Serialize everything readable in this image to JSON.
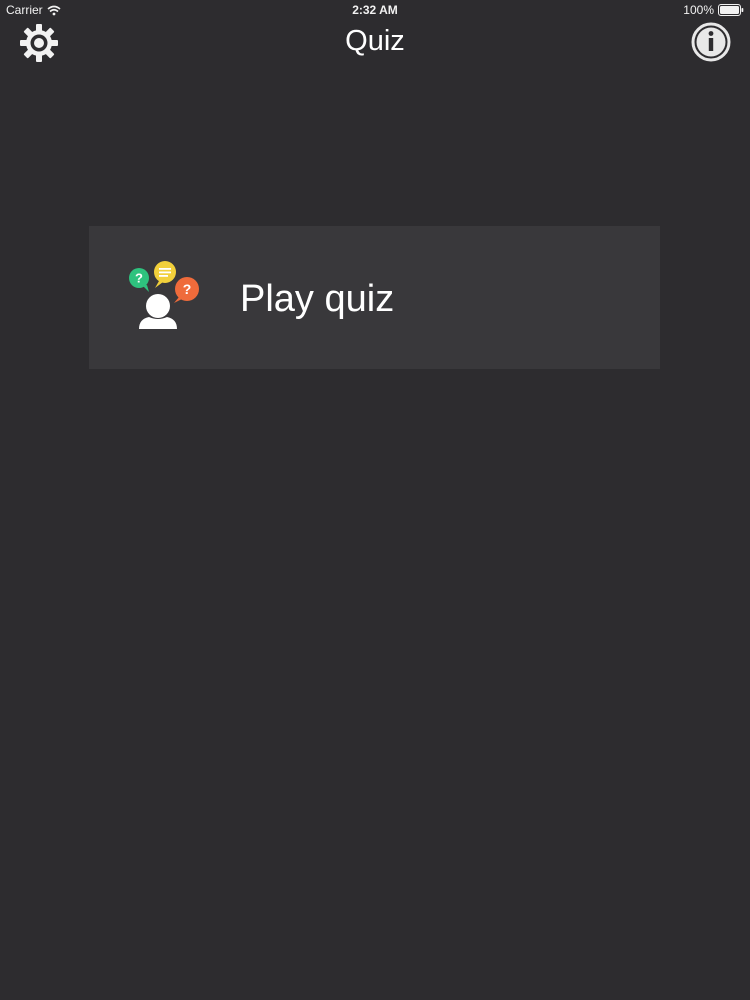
{
  "status_bar": {
    "carrier": "Carrier",
    "time": "2:32 AM",
    "battery": "100%"
  },
  "nav": {
    "title": "Quiz",
    "left_icon": "gear-icon",
    "right_icon": "info-icon"
  },
  "menu": {
    "items": [
      {
        "label": "Play quiz",
        "icon": "quiz-people-icon"
      }
    ]
  },
  "colors": {
    "background": "#2d2c2f",
    "card": "#39383b",
    "text": "#ffffff",
    "bubble_green": "#2ec27e",
    "bubble_yellow": "#f2d03b",
    "bubble_orange": "#ef6b3b"
  }
}
